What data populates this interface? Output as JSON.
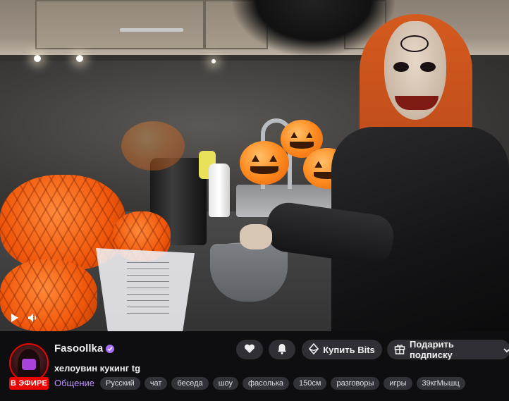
{
  "video": {
    "play_icon": "play-icon",
    "volume_icon": "volume-icon"
  },
  "channel": {
    "name": "Fasoollka",
    "verified_icon": "verified-check-icon",
    "live_badge": "В ЭФИРЕ",
    "stream_title": "хелоувин кукинг tg",
    "category": "Общение",
    "accent_color": "#a970ff",
    "live_color": "#eb0400"
  },
  "tags": [
    "Русский",
    "чат",
    "беседа",
    "шоу",
    "фасолька",
    "150см",
    "разговоры",
    "игры",
    "39кгМышц"
  ],
  "actions": {
    "follow_icon": "heart-icon",
    "notify_icon": "bell-icon",
    "bits_label": "Купить Bits",
    "bits_icon": "bits-gem-icon",
    "gift_label": "Подарить подписку",
    "gift_icon": "gift-icon",
    "gift_chevron_icon": "chevron-down-icon"
  }
}
